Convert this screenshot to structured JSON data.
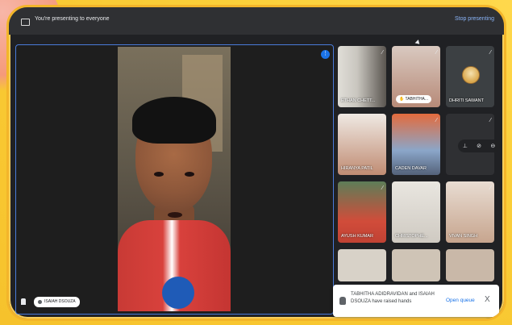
{
  "topbar": {
    "presenting_text": "You're presenting to everyone",
    "stop_label": "Stop presenting"
  },
  "main": {
    "name": "ISAIAH DSOUZA",
    "more_icon": "more-vert-icon"
  },
  "participants": [
    {
      "name": "ETHAN CHETT...",
      "muted": true
    },
    {
      "name": "TABHITHA...",
      "muted": true,
      "raised_hand": true
    },
    {
      "name": "DHRITI SAWANT",
      "muted": true
    },
    {
      "name": "HIRANYA PATIL",
      "muted": true
    },
    {
      "name": "CADEN DAVAR",
      "muted": true
    },
    {
      "name": "",
      "muted": true
    },
    {
      "name": "AYUSH KUMAR",
      "muted": true
    },
    {
      "name": "CHRISTOPHE...",
      "muted": true
    },
    {
      "name": "VIVAN SINGH",
      "muted": true
    },
    {
      "name": "",
      "muted": false
    },
    {
      "name": "",
      "muted": false
    },
    {
      "name": "",
      "muted": false
    }
  ],
  "toast": {
    "message": "TABHITHA ADIDRAVIDAN and ISAIAH DSOUZA have raised hands",
    "open_queue": "Open queue",
    "close": "X"
  },
  "colors": {
    "accent_blue": "#1a73e8",
    "frame_yellow": "#f3b52a",
    "meet_dark": "#202124"
  }
}
